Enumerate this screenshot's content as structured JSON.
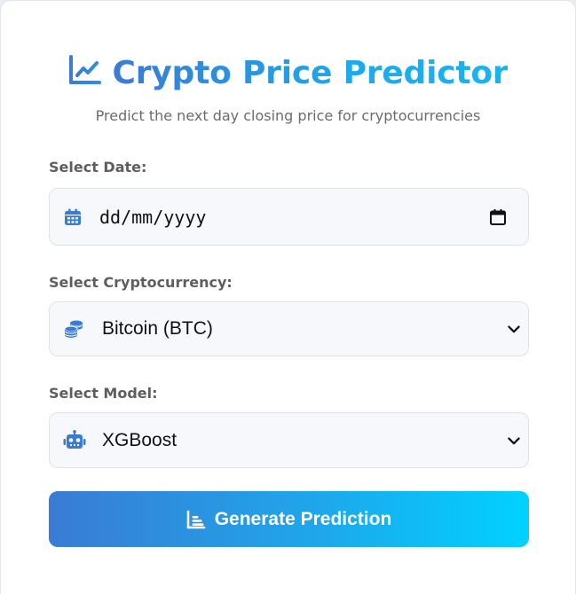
{
  "header": {
    "title": "Crypto Price Predictor",
    "subtitle": "Predict the next day closing price for cryptocurrencies",
    "title_icon": "chart-line-icon"
  },
  "form": {
    "date": {
      "label": "Select Date:",
      "placeholder": "dd/mm/yyyy",
      "icon": "calendar-icon",
      "picker_icon": "calendar-picker-icon"
    },
    "crypto": {
      "label": "Select Cryptocurrency:",
      "selected": "Bitcoin (BTC)",
      "icon": "coins-icon"
    },
    "model": {
      "label": "Select Model:",
      "selected": "XGBoost",
      "icon": "robot-icon"
    },
    "submit": {
      "label": "Generate Prediction",
      "icon": "bar-chart-icon"
    }
  },
  "colors": {
    "accent_start": "#3a7bd5",
    "accent_end": "#00d2ff",
    "field_bg": "#f7f8fb",
    "label_text": "#5e5e5e"
  }
}
